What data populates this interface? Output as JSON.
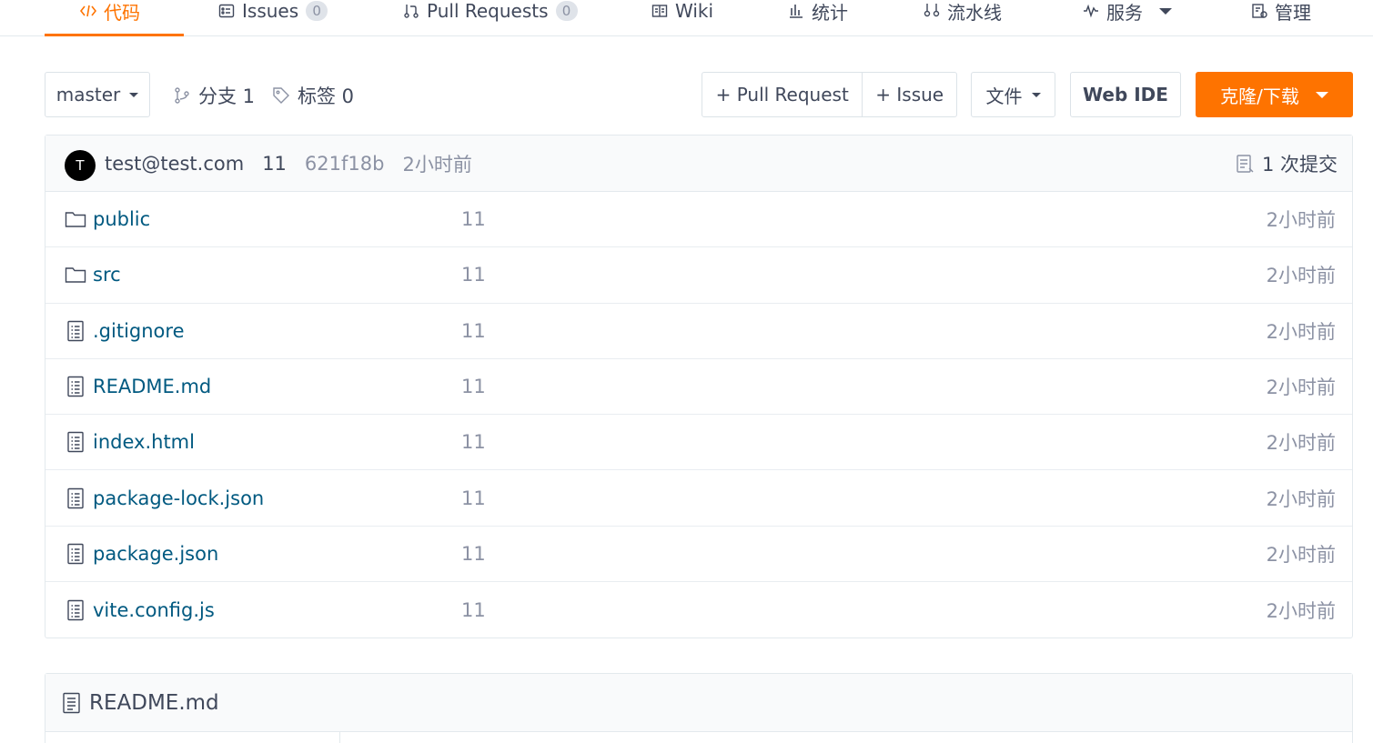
{
  "tabs": [
    {
      "id": "code",
      "label": "代码",
      "icon": "code-icon",
      "active": true
    },
    {
      "id": "issues",
      "label": "Issues",
      "icon": "issues-icon",
      "badge": "0"
    },
    {
      "id": "pulls",
      "label": "Pull Requests",
      "icon": "pull-request-icon",
      "badge": "0"
    },
    {
      "id": "wiki",
      "label": "Wiki",
      "icon": "wiki-icon"
    },
    {
      "id": "stats",
      "label": "统计",
      "icon": "stats-icon"
    },
    {
      "id": "pipeline",
      "label": "流水线",
      "icon": "pipeline-icon"
    },
    {
      "id": "services",
      "label": "服务",
      "icon": "services-icon"
    },
    {
      "id": "manage",
      "label": "管理",
      "icon": "manage-icon"
    }
  ],
  "toolbar": {
    "branch_select": "master",
    "branches_label": "分支 1",
    "tags_label": "标签 0",
    "pull_request_label": "+ Pull Request",
    "issue_label": "+ Issue",
    "file_label": "文件",
    "web_ide_label": "Web IDE",
    "clone_label": "克隆/下载"
  },
  "commit": {
    "avatar_initial": "T",
    "author": "test@test.com",
    "message": "11",
    "sha": "621f18b",
    "time": "2小时前",
    "count_label": "1 次提交"
  },
  "files": [
    {
      "name": "public",
      "type": "folder",
      "message": "11",
      "time": "2小时前"
    },
    {
      "name": "src",
      "type": "folder",
      "message": "11",
      "time": "2小时前"
    },
    {
      "name": ".gitignore",
      "type": "file",
      "message": "11",
      "time": "2小时前"
    },
    {
      "name": "README.md",
      "type": "file",
      "message": "11",
      "time": "2小时前"
    },
    {
      "name": "index.html",
      "type": "file",
      "message": "11",
      "time": "2小时前"
    },
    {
      "name": "package-lock.json",
      "type": "file",
      "message": "11",
      "time": "2小时前"
    },
    {
      "name": "package.json",
      "type": "file",
      "message": "11",
      "time": "2小时前"
    },
    {
      "name": "vite.config.js",
      "type": "file",
      "message": "11",
      "time": "2小时前"
    }
  ],
  "readme": {
    "title": "README.md"
  },
  "colors": {
    "accent": "#fe7300",
    "link": "#005980",
    "muted": "#8c92a4",
    "text": "#40485b",
    "border": "#e3e9ed"
  }
}
